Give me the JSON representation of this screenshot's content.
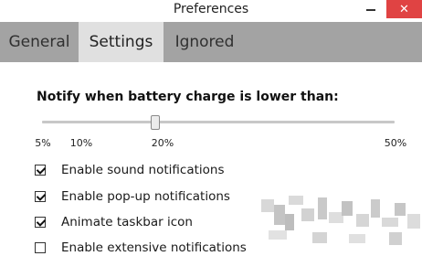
{
  "window": {
    "title": "Preferences"
  },
  "tabs": [
    {
      "label": "General",
      "active": false
    },
    {
      "label": "Settings",
      "active": true
    },
    {
      "label": "Ignored",
      "active": false
    }
  ],
  "settings": {
    "heading": "Notify when battery charge is lower than:",
    "slider": {
      "value": 20,
      "ticks": [
        "5%",
        "10%",
        "20%",
        "50%"
      ]
    },
    "options": [
      {
        "label": "Enable sound notifications",
        "checked": true
      },
      {
        "label": "Enable pop-up notifications",
        "checked": true
      },
      {
        "label": "Animate taskbar icon",
        "checked": true
      },
      {
        "label": "Enable extensive notifications",
        "checked": false
      }
    ]
  },
  "icons": {
    "minimize": "minimize-icon",
    "close": "close-icon",
    "close_color": "#e04343"
  }
}
